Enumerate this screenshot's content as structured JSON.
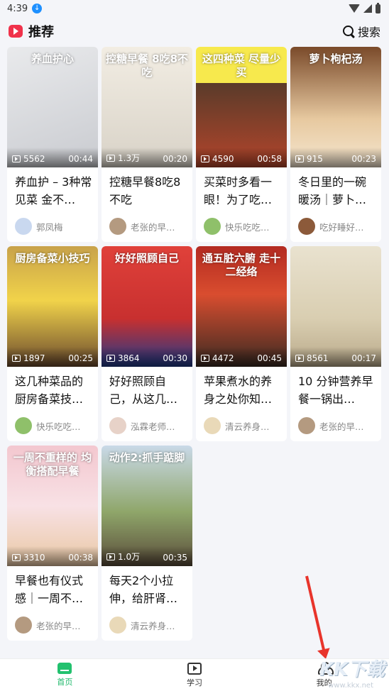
{
  "status": {
    "time": "4:39",
    "download_glyph": "↓"
  },
  "header": {
    "title": "推荐",
    "search_label": "搜索"
  },
  "colors": {
    "accent": "#1db86a",
    "brand": "#f0324b"
  },
  "videos": [
    {
      "thumb_text": "养血护心",
      "thumb_bg": "linear-gradient(160deg,#e9eaec,#c9cbd0)",
      "views": "5562",
      "duration": "00:44",
      "title": "养血护 – 3种常见菜 金不…",
      "author": "郭凤梅",
      "avatar": "#c9d8ef"
    },
    {
      "thumb_text": "控糖早餐 8吃8不吃",
      "thumb_bg": "linear-gradient(180deg,#f2ede3,#d8d2c7)",
      "views": "1.3万",
      "duration": "00:20",
      "title": "控糖早餐8吃8不吃",
      "author": "老张的早…",
      "avatar": "#b49a80"
    },
    {
      "thumb_text": "这四种菜 尽量少买",
      "thumb_bg": "linear-gradient(180deg,#f7e94d 0%,#f7e94d 30%,#5a3b2a 30%,#b3452b 100%)",
      "views": "4590",
      "duration": "00:58",
      "title": "买菜时多看一眼！为了吃…",
      "author": "快乐吃吃…",
      "avatar": "#8fc06a"
    },
    {
      "thumb_text": "萝卜枸杞汤",
      "thumb_bg": "linear-gradient(180deg,#7a4a2a,#e7c9a0 60%,#f5e6cf)",
      "views": "915",
      "duration": "00:23",
      "title": "冬日里的一碗暖汤｜萝卜…",
      "author": "吃好睡好…",
      "avatar": "#8c5a3a"
    },
    {
      "thumb_text": "厨房备菜小技巧",
      "thumb_bg": "linear-gradient(180deg,#c8a24a,#f1d34a 45%,#6b4a2e)",
      "views": "1897",
      "duration": "00:25",
      "title": "这几种菜品的厨房备菜技…",
      "author": "快乐吃吃…",
      "avatar": "#8fc06a"
    },
    {
      "thumb_text": "好好照顾自己",
      "thumb_bg": "linear-gradient(180deg,#e0413a,#c8302f 60%,#1f3a8a)",
      "views": "3864",
      "duration": "00:30",
      "title": "好好照顾自己，从这几件…",
      "author": "泓霖老师…",
      "avatar": "#e7d2c8"
    },
    {
      "thumb_text": "通五脏六腑 走十二经络",
      "thumb_bg": "linear-gradient(180deg,#b32a21,#d94d2f 40%,#3a2a22)",
      "views": "4472",
      "duration": "00:45",
      "title": "苹果煮水的养身之处你知…",
      "author": "清云养身…",
      "avatar": "#e9d9b8"
    },
    {
      "thumb_text": "",
      "thumb_bg": "linear-gradient(180deg,#e9e2cf,#d9ceb1 60%,#b9a98a)",
      "views": "8561",
      "duration": "00:17",
      "title": "10 分钟营养早餐一锅出…",
      "author": "老张的早…",
      "avatar": "#b49a80"
    },
    {
      "thumb_text": "一周不重样的 均衡搭配早餐",
      "thumb_bg": "linear-gradient(180deg,#f3c7cf,#f8e1e5 50%,#e9c8a3)",
      "views": "3310",
      "duration": "00:38",
      "title": "早餐也有仪式感｜一周不…",
      "author": "老张的早…",
      "avatar": "#b49a80"
    },
    {
      "thumb_text": "动作2:抓手踮脚",
      "thumb_bg": "linear-gradient(180deg,#c9d9e8,#8fa66a 55%,#5a4c3a)",
      "views": "1.0万",
      "duration": "00:35",
      "title": "每天2个小拉伸，给肝肾…",
      "author": "清云养身…",
      "avatar": "#e9d9b8"
    }
  ],
  "tabs": {
    "home": "首页",
    "learn": "学习",
    "mine": "我的"
  },
  "watermark": {
    "logo": "KK下载",
    "url": "www.kkx.net"
  }
}
